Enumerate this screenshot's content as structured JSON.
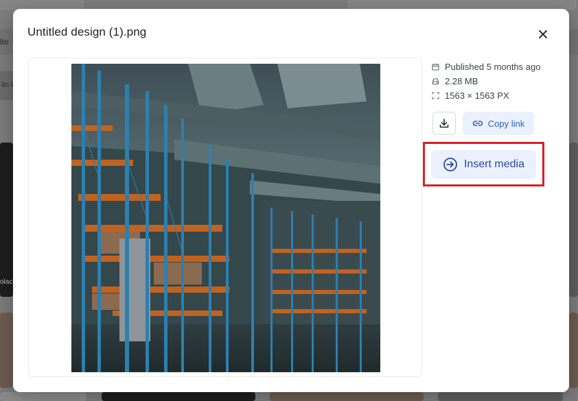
{
  "background": {
    "filter_label_partial": "lte",
    "chip_label_partial": "lin l",
    "card_caption_partial": "olac"
  },
  "modal": {
    "title": "Untitled design (1).png",
    "close_icon": "close-icon",
    "meta": {
      "published": "Published 5 months ago",
      "size": "2.28 MB",
      "dimensions": "1563 × 1563 PX"
    },
    "actions": {
      "copy_link_label": "Copy link",
      "insert_media_label": "Insert media"
    }
  },
  "colors": {
    "accent": "#2f5fbf",
    "accent_bg": "#eaf1fc",
    "highlight": "#d81e26"
  }
}
